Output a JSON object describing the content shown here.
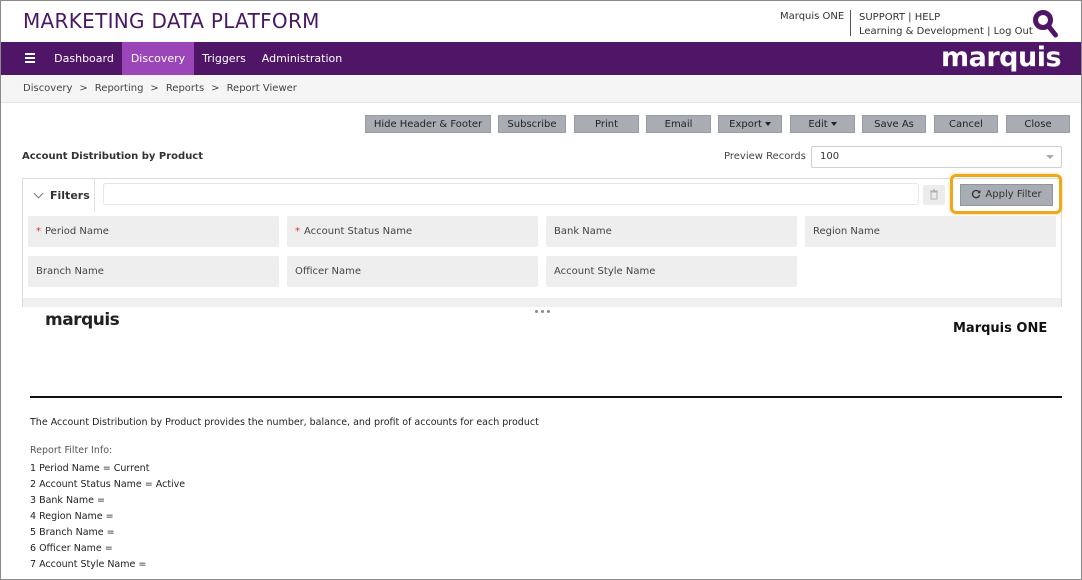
{
  "header": {
    "app_title": "MARKETING DATA PLATFORM",
    "user_name": "Marquis ONE",
    "support": "SUPPORT",
    "help": "HELP",
    "learning": "Learning & Development",
    "logout": "Log Out",
    "pipe": "|",
    "logo_icon": "q-search-icon"
  },
  "nav": {
    "items": [
      {
        "label": "Dashboard"
      },
      {
        "label": "Discovery",
        "active": true
      },
      {
        "label": "Triggers"
      },
      {
        "label": "Administration"
      }
    ],
    "brand": "marquis"
  },
  "breadcrumb": {
    "items": [
      "Discovery",
      "Reporting",
      "Reports",
      "Report Viewer"
    ],
    "separator": ">"
  },
  "toolbar": {
    "hide_header_footer": "Hide Header & Footer",
    "subscribe": "Subscribe",
    "print": "Print",
    "email": "Email",
    "export": "Export",
    "edit": "Edit",
    "save_as": "Save As",
    "cancel": "Cancel",
    "close": "Close"
  },
  "report": {
    "title": "Account Distribution by Product",
    "preview_label": "Preview Records",
    "preview_value": "100"
  },
  "filters": {
    "label": "Filters",
    "apply_label": "Apply Filter",
    "required_mark": "*",
    "fields": [
      {
        "label": "Period Name",
        "required": true
      },
      {
        "label": "Account Status Name",
        "required": true
      },
      {
        "label": "Bank Name",
        "required": false
      },
      {
        "label": "Region Name",
        "required": false
      },
      {
        "label": "Branch Name",
        "required": false
      },
      {
        "label": "Officer Name",
        "required": false
      },
      {
        "label": "Account Style Name",
        "required": false
      }
    ]
  },
  "report_body": {
    "logo": "marquis",
    "org_name": "Marquis ONE",
    "description": "The Account Distribution by Product provides the number, balance, and profit of accounts for each product",
    "filter_info_title": "Report Filter Info:",
    "filter_lines": [
      "1 Period Name = Current",
      "2 Account Status Name = Active",
      "3 Bank Name =",
      "4 Region Name =",
      "5 Branch Name =",
      "6 Officer Name =",
      "7 Account Style Name ="
    ]
  },
  "colors": {
    "brand_purple": "#4f1567",
    "nav_active": "#9a46b9",
    "title_purple": "#4a1763",
    "highlight": "#f0a818",
    "button_gray": "#a7adb3"
  }
}
